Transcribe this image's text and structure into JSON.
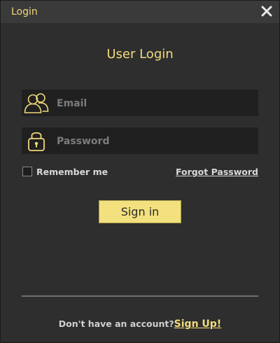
{
  "window": {
    "title": "Login",
    "close_icon": "close-icon"
  },
  "form": {
    "heading": "User Login",
    "email": {
      "placeholder": "Email",
      "value": "",
      "icon": "users-icon"
    },
    "password": {
      "placeholder": "Password",
      "value": "",
      "icon": "lock-icon"
    },
    "remember_label": "Remember me",
    "remember_checked": false,
    "forgot_label": "Forgot Password",
    "signin_label": "Sign in"
  },
  "footer": {
    "prompt": "Don't have an account?",
    "signup_label": "Sign Up!"
  },
  "colors": {
    "accent": "#f3dc7d",
    "button": "#f3e17f",
    "background": "#2e2e2e",
    "field": "#202020"
  }
}
